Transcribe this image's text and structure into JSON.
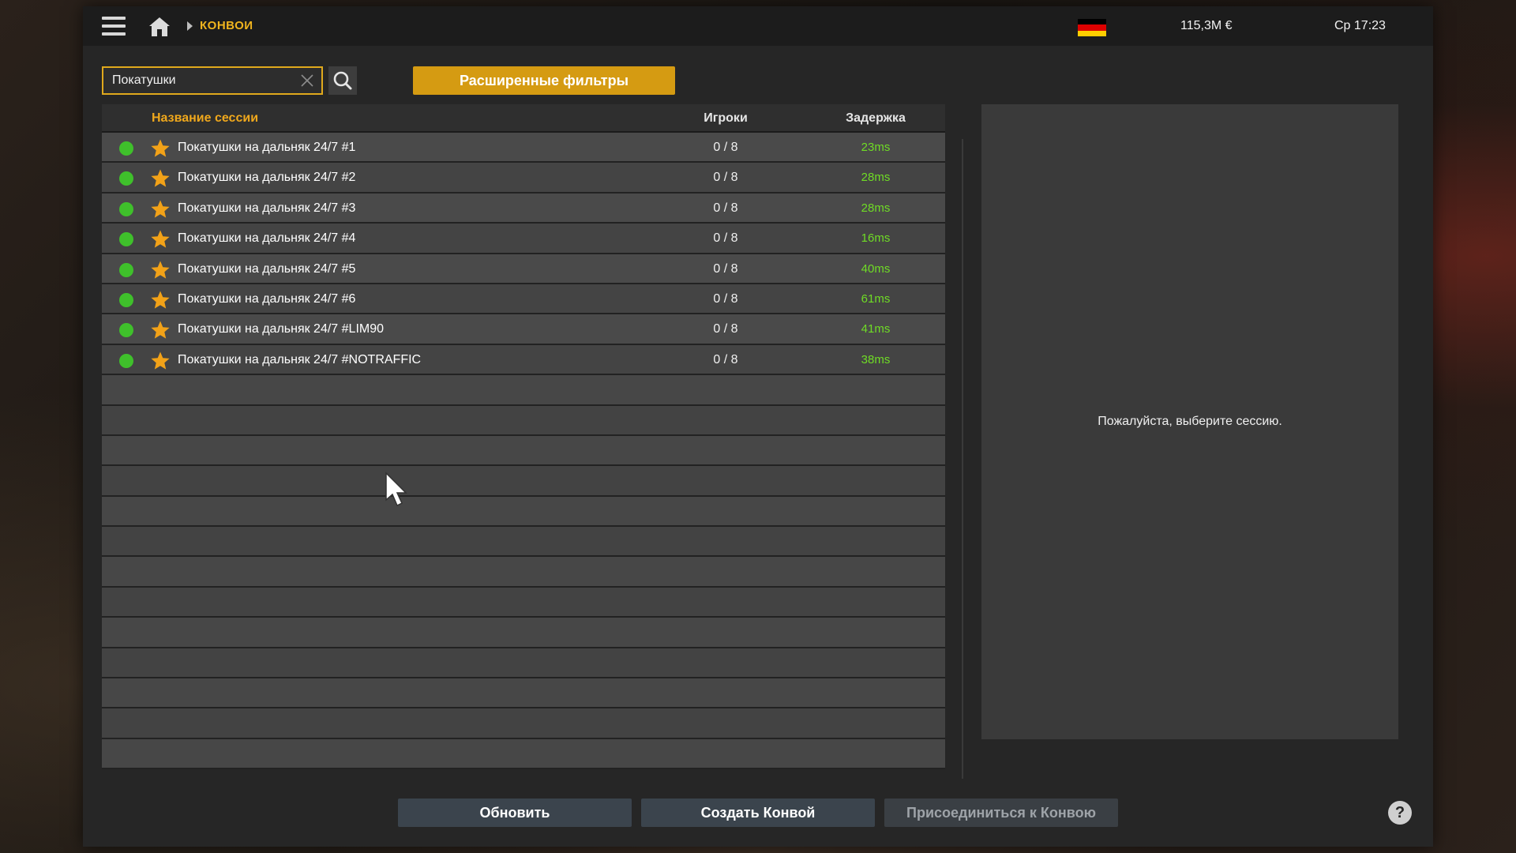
{
  "topbar": {
    "breadcrumb": "КОНВОИ",
    "money": "115,3M  €",
    "clock": "Ср 17:23",
    "flag_colors": [
      "#000000",
      "#dd0000",
      "#ffce00"
    ]
  },
  "search": {
    "value": "Покатушки",
    "placeholder": ""
  },
  "filters_label": "Расширенные фильтры",
  "table": {
    "headers": {
      "name": "Название сессии",
      "players": "Игроки",
      "latency": "Задержка"
    },
    "rows": [
      {
        "name": "Покатушки на дальняк 24/7 #1",
        "players": "0 / 8",
        "latency": "23ms"
      },
      {
        "name": "Покатушки на дальняк 24/7 #2",
        "players": "0 / 8",
        "latency": "28ms"
      },
      {
        "name": "Покатушки на дальняк 24/7 #3",
        "players": "0 / 8",
        "latency": "28ms"
      },
      {
        "name": "Покатушки на дальняк 24/7 #4",
        "players": "0 / 8",
        "latency": "16ms"
      },
      {
        "name": "Покатушки на дальняк 24/7 #5",
        "players": "0 / 8",
        "latency": "40ms"
      },
      {
        "name": "Покатушки на дальняк 24/7 #6",
        "players": "0 / 8",
        "latency": "61ms"
      },
      {
        "name": "Покатушки на дальняк 24/7 #LIM90",
        "players": "0 / 8",
        "latency": "41ms"
      },
      {
        "name": "Покатушки на дальняк 24/7 #NOTRAFFIC",
        "players": "0 / 8",
        "latency": "38ms"
      }
    ]
  },
  "details": {
    "message": "Пожалуйста, выберите сессию."
  },
  "buttons": {
    "refresh": "Обновить",
    "create": "Создать Конвой",
    "join": "Присоединиться к Конвою",
    "help": "?"
  },
  "colors": {
    "accent": "#d59b12",
    "status_online": "#3fc02b",
    "latency_good": "#6fdc25",
    "favorite_star": "#f2a218"
  }
}
